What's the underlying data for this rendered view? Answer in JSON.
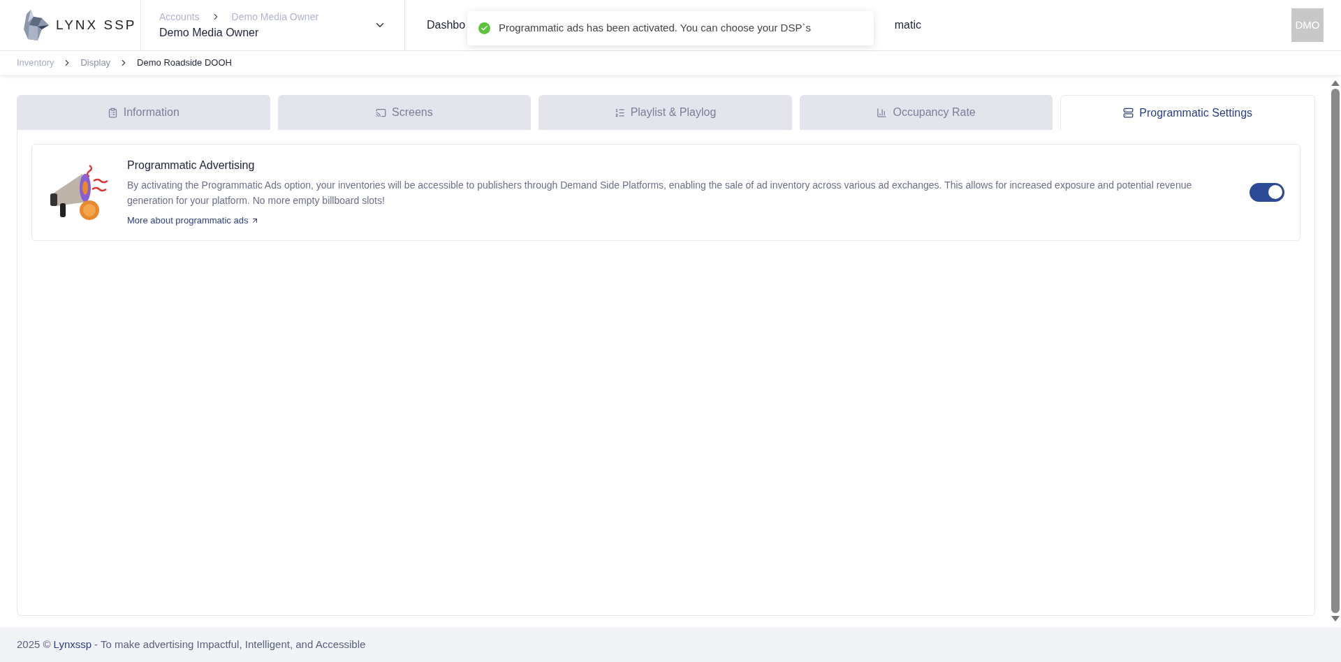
{
  "logo": {
    "text": "LYNX SSP"
  },
  "account": {
    "breadcrumb": [
      "Accounts",
      "Demo Media Owner"
    ],
    "name": "Demo Media Owner"
  },
  "nav": [
    {
      "label": "Dashbo"
    },
    {
      "label": "matic"
    }
  ],
  "toast": {
    "message": "Programmatic ads has been activated. You can choose your DSP`s",
    "kind": "success"
  },
  "avatar": {
    "initials": "DMO"
  },
  "breadcrumb": [
    {
      "label": "Inventory",
      "current": false
    },
    {
      "label": "Display",
      "current": false
    },
    {
      "label": "Demo Roadside DOOH",
      "current": true
    }
  ],
  "tabs": [
    {
      "label": "Information",
      "selected": false
    },
    {
      "label": "Screens",
      "selected": false
    },
    {
      "label": "Playlist & Playlog",
      "selected": false
    },
    {
      "label": "Occupancy Rate",
      "selected": false
    },
    {
      "label": "Programmatic Settings",
      "selected": true
    }
  ],
  "setting": {
    "title": "Programmatic Advertising",
    "description": "By activating the Programmatic Ads option, your inventories will be accessible to publishers through Demand Side Platforms, enabling the sale of ad inventory across various ad exchanges. This allows for increased exposure and potential revenue generation for your platform. No more empty billboard slots!",
    "link": "More about programmatic ads",
    "on": true
  },
  "footer": {
    "prefix": "2025 ©",
    "brand": "Lynxssp",
    "suffix": "- To make advertising Impactful, Intelligent, and Accessible"
  }
}
